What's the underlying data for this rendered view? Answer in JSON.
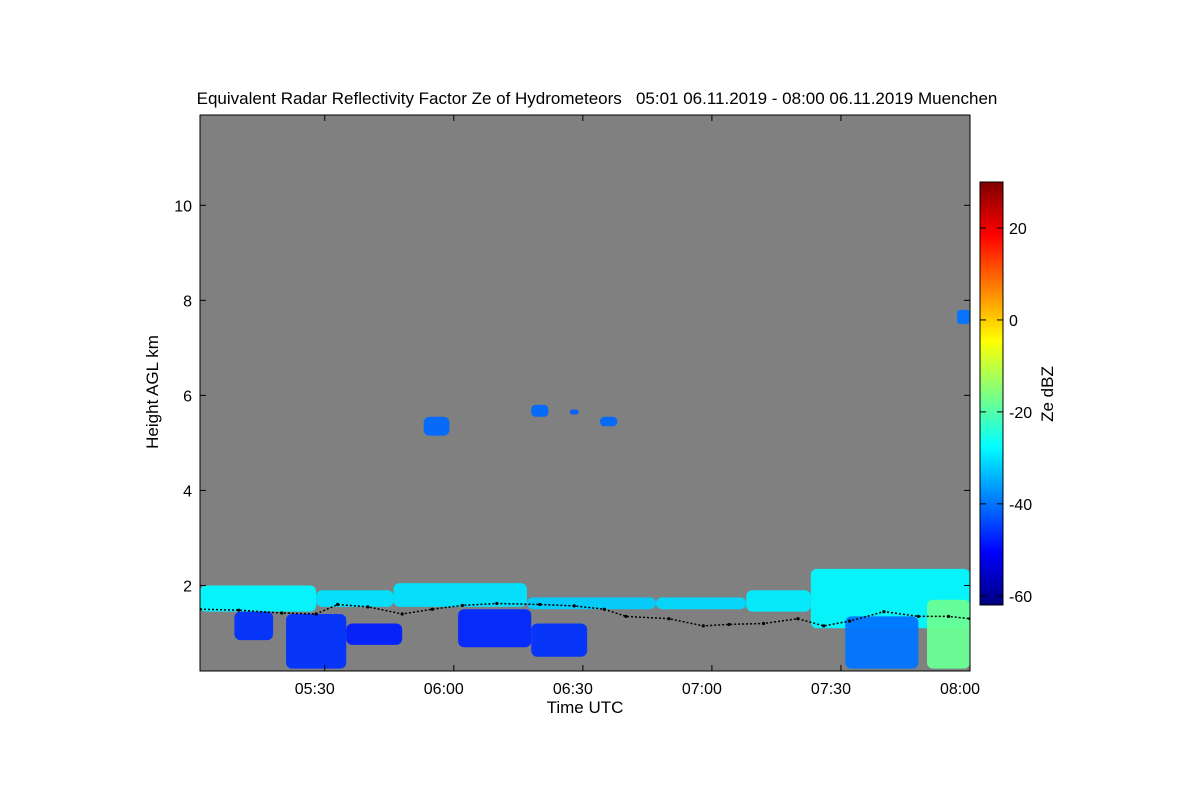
{
  "chart_data": {
    "type": "heatmap",
    "title": "Equivalent Radar Reflectivity Factor Ze of Hydrometeors   05:01 06.11.2019 - 08:00 06.11.2019 Muenchen",
    "xlabel": "Time UTC",
    "ylabel": "Height AGL km",
    "x_unit": "minutes after 05:00 UTC",
    "xlim": [
      1,
      180
    ],
    "ylim": [
      0.2,
      11.9
    ],
    "x_ticks": [
      {
        "value": 30,
        "label": "05:30"
      },
      {
        "value": 60,
        "label": "06:00"
      },
      {
        "value": 90,
        "label": "06:30"
      },
      {
        "value": 120,
        "label": "07:00"
      },
      {
        "value": 150,
        "label": "07:30"
      },
      {
        "value": 180,
        "label": "08:00"
      }
    ],
    "y_ticks": [
      {
        "value": 2,
        "label": "2"
      },
      {
        "value": 4,
        "label": "4"
      },
      {
        "value": 6,
        "label": "6"
      },
      {
        "value": 8,
        "label": "8"
      },
      {
        "value": 10,
        "label": "10"
      }
    ],
    "background_color": "#808080",
    "colorbar": {
      "label": "Ze dBZ",
      "range": [
        -62,
        30
      ],
      "ticks": [
        {
          "value": -60,
          "label": "-60"
        },
        {
          "value": -40,
          "label": "-40"
        },
        {
          "value": -20,
          "label": "-20"
        },
        {
          "value": 0,
          "label": "0"
        },
        {
          "value": 20,
          "label": "20"
        }
      ],
      "colormap": [
        "#00007f",
        "#0000ff",
        "#007fff",
        "#00ffff",
        "#7fff7f",
        "#ffff00",
        "#ff7f00",
        "#ff0000",
        "#7f0000"
      ]
    },
    "echo_regions": [
      {
        "t0": 1,
        "t1": 28,
        "h0": 1.45,
        "h1": 2.0,
        "ze": -28
      },
      {
        "t0": 28,
        "t1": 46,
        "h0": 1.55,
        "h1": 1.9,
        "ze": -30
      },
      {
        "t0": 46,
        "t1": 77,
        "h0": 1.55,
        "h1": 2.05,
        "ze": -30
      },
      {
        "t0": 77,
        "t1": 107,
        "h0": 1.5,
        "h1": 1.75,
        "ze": -32
      },
      {
        "t0": 107,
        "t1": 128,
        "h0": 1.5,
        "h1": 1.75,
        "ze": -31
      },
      {
        "t0": 128,
        "t1": 143,
        "h0": 1.45,
        "h1": 1.9,
        "ze": -29
      },
      {
        "t0": 143,
        "t1": 180,
        "h0": 1.1,
        "h1": 2.35,
        "ze": -28
      },
      {
        "t0": 170,
        "t1": 180,
        "h0": 0.25,
        "h1": 1.7,
        "ze": -18
      },
      {
        "t0": 21,
        "t1": 35,
        "h0": 0.25,
        "h1": 1.4,
        "ze": -46
      },
      {
        "t0": 35,
        "t1": 48,
        "h0": 0.75,
        "h1": 1.2,
        "ze": -48
      },
      {
        "t0": 61,
        "t1": 78,
        "h0": 0.7,
        "h1": 1.5,
        "ze": -47
      },
      {
        "t0": 78,
        "t1": 91,
        "h0": 0.5,
        "h1": 1.2,
        "ze": -46
      },
      {
        "t0": 151,
        "t1": 168,
        "h0": 0.25,
        "h1": 1.35,
        "ze": -40
      },
      {
        "t0": 9,
        "t1": 18,
        "h0": 0.85,
        "h1": 1.45,
        "ze": -46
      },
      {
        "t0": 53,
        "t1": 59,
        "h0": 5.15,
        "h1": 5.55,
        "ze": -41
      },
      {
        "t0": 78,
        "t1": 82,
        "h0": 5.55,
        "h1": 5.8,
        "ze": -41
      },
      {
        "t0": 87,
        "t1": 89,
        "h0": 5.6,
        "h1": 5.7,
        "ze": -42
      },
      {
        "t0": 94,
        "t1": 98,
        "h0": 5.35,
        "h1": 5.55,
        "ze": -41
      },
      {
        "t0": 177,
        "t1": 180,
        "h0": 7.5,
        "h1": 7.8,
        "ze": -40
      }
    ],
    "cloud_base_trace": [
      {
        "t": 1,
        "h": 1.5
      },
      {
        "t": 10,
        "h": 1.48
      },
      {
        "t": 20,
        "h": 1.42
      },
      {
        "t": 28,
        "h": 1.4
      },
      {
        "t": 33,
        "h": 1.6
      },
      {
        "t": 40,
        "h": 1.55
      },
      {
        "t": 48,
        "h": 1.4
      },
      {
        "t": 55,
        "h": 1.5
      },
      {
        "t": 62,
        "h": 1.58
      },
      {
        "t": 70,
        "h": 1.62
      },
      {
        "t": 80,
        "h": 1.6
      },
      {
        "t": 88,
        "h": 1.57
      },
      {
        "t": 95,
        "h": 1.5
      },
      {
        "t": 100,
        "h": 1.35
      },
      {
        "t": 110,
        "h": 1.3
      },
      {
        "t": 118,
        "h": 1.15
      },
      {
        "t": 124,
        "h": 1.18
      },
      {
        "t": 132,
        "h": 1.2
      },
      {
        "t": 140,
        "h": 1.3
      },
      {
        "t": 146,
        "h": 1.15
      },
      {
        "t": 152,
        "h": 1.25
      },
      {
        "t": 160,
        "h": 1.45
      },
      {
        "t": 168,
        "h": 1.35
      },
      {
        "t": 175,
        "h": 1.35
      },
      {
        "t": 180,
        "h": 1.3
      }
    ]
  }
}
